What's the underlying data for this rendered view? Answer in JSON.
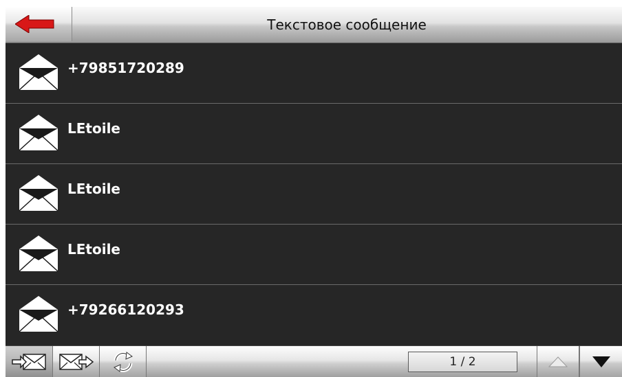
{
  "header": {
    "title": "Текстовое сообщение",
    "back_icon": "arrow-left-icon",
    "back_color": "#d81818"
  },
  "messages": [
    {
      "sender": "+79851720289",
      "icon": "envelope-icon"
    },
    {
      "sender": "LEtoile",
      "icon": "envelope-icon"
    },
    {
      "sender": "LEtoile",
      "icon": "envelope-icon"
    },
    {
      "sender": "LEtoile",
      "icon": "envelope-icon"
    },
    {
      "sender": "+79266120293",
      "icon": "envelope-icon"
    }
  ],
  "footer": {
    "inbox_icon": "inbox-icon",
    "outbox_icon": "outbox-icon",
    "refresh_icon": "refresh-icon",
    "page_indicator": "1 / 2",
    "up_icon": "arrow-up-icon",
    "down_icon": "arrow-down-icon"
  }
}
